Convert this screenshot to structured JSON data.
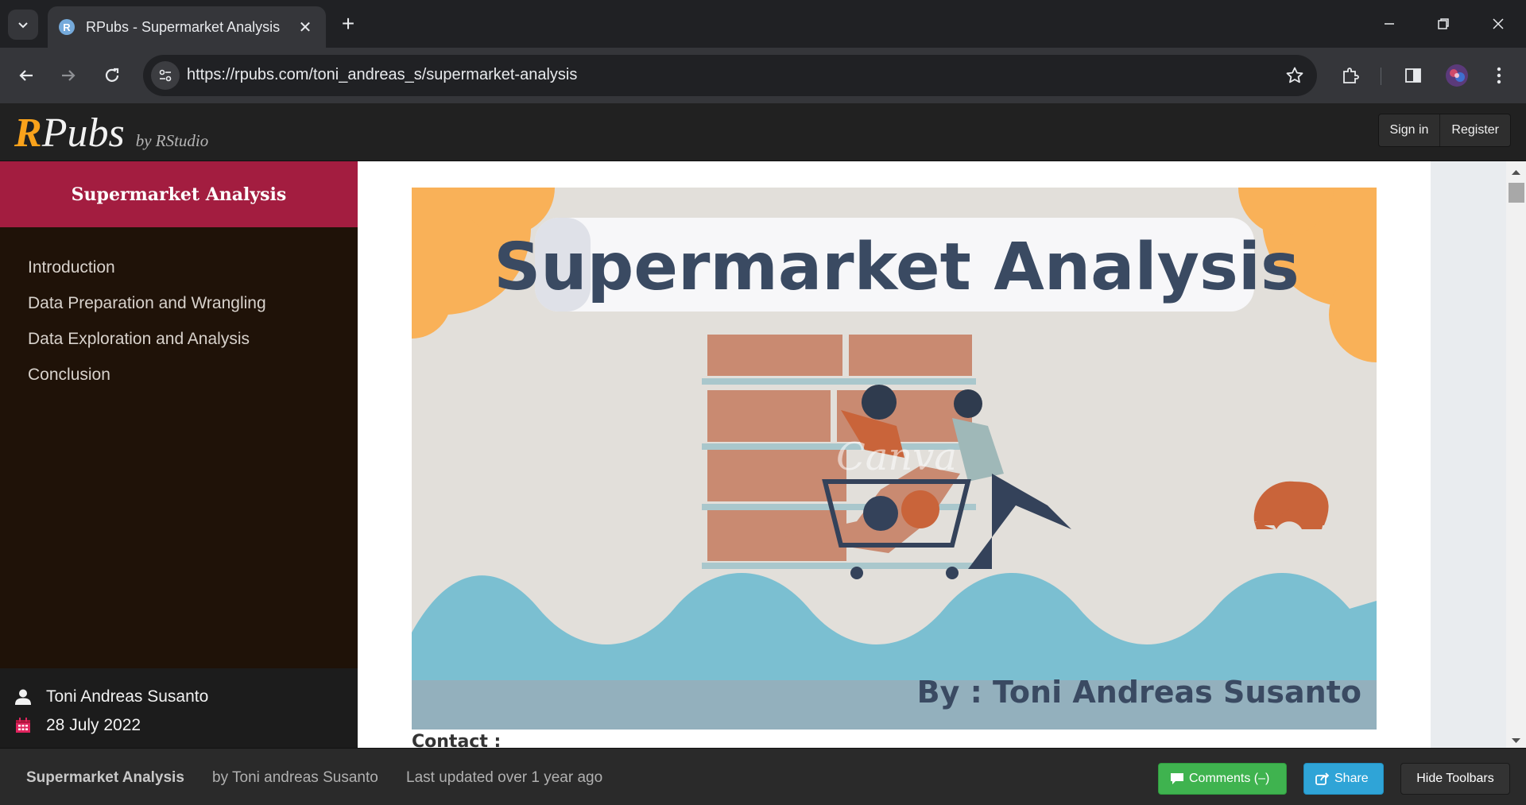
{
  "browser": {
    "tab_title": "RPubs - Supermarket Analysis",
    "favicon_letter": "R",
    "url": "https://rpubs.com/toni_andreas_s/supermarket-analysis"
  },
  "header": {
    "logo_r": "R",
    "logo_pubs": "Pubs",
    "logo_by": "by RStudio",
    "sign_in": "Sign in",
    "register": "Register"
  },
  "sidebar": {
    "title": "Supermarket Analysis",
    "toc": [
      {
        "label": "Introduction"
      },
      {
        "label": "Data Preparation and Wrangling"
      },
      {
        "label": "Data Exploration and Analysis"
      },
      {
        "label": "Conclusion"
      }
    ],
    "author": "Toni Andreas Susanto",
    "date": "28 July 2022"
  },
  "content": {
    "banner_title": "Supermarket Analysis",
    "banner_byline": "By : Toni Andreas Susanto",
    "banner_watermark": "Canva",
    "contact_heading": "Contact :"
  },
  "bottom_bar": {
    "title": "Supermarket Analysis",
    "author": "by Toni andreas Susanto",
    "updated": "Last updated over 1 year ago",
    "comments": "Comments (–)",
    "share": "Share",
    "hide": "Hide Toolbars"
  },
  "colors": {
    "sidebar_accent": "#a31d40",
    "logo_orange": "#f9a21b",
    "comments_green": "#3fb34f",
    "share_blue": "#2fa4d7"
  }
}
